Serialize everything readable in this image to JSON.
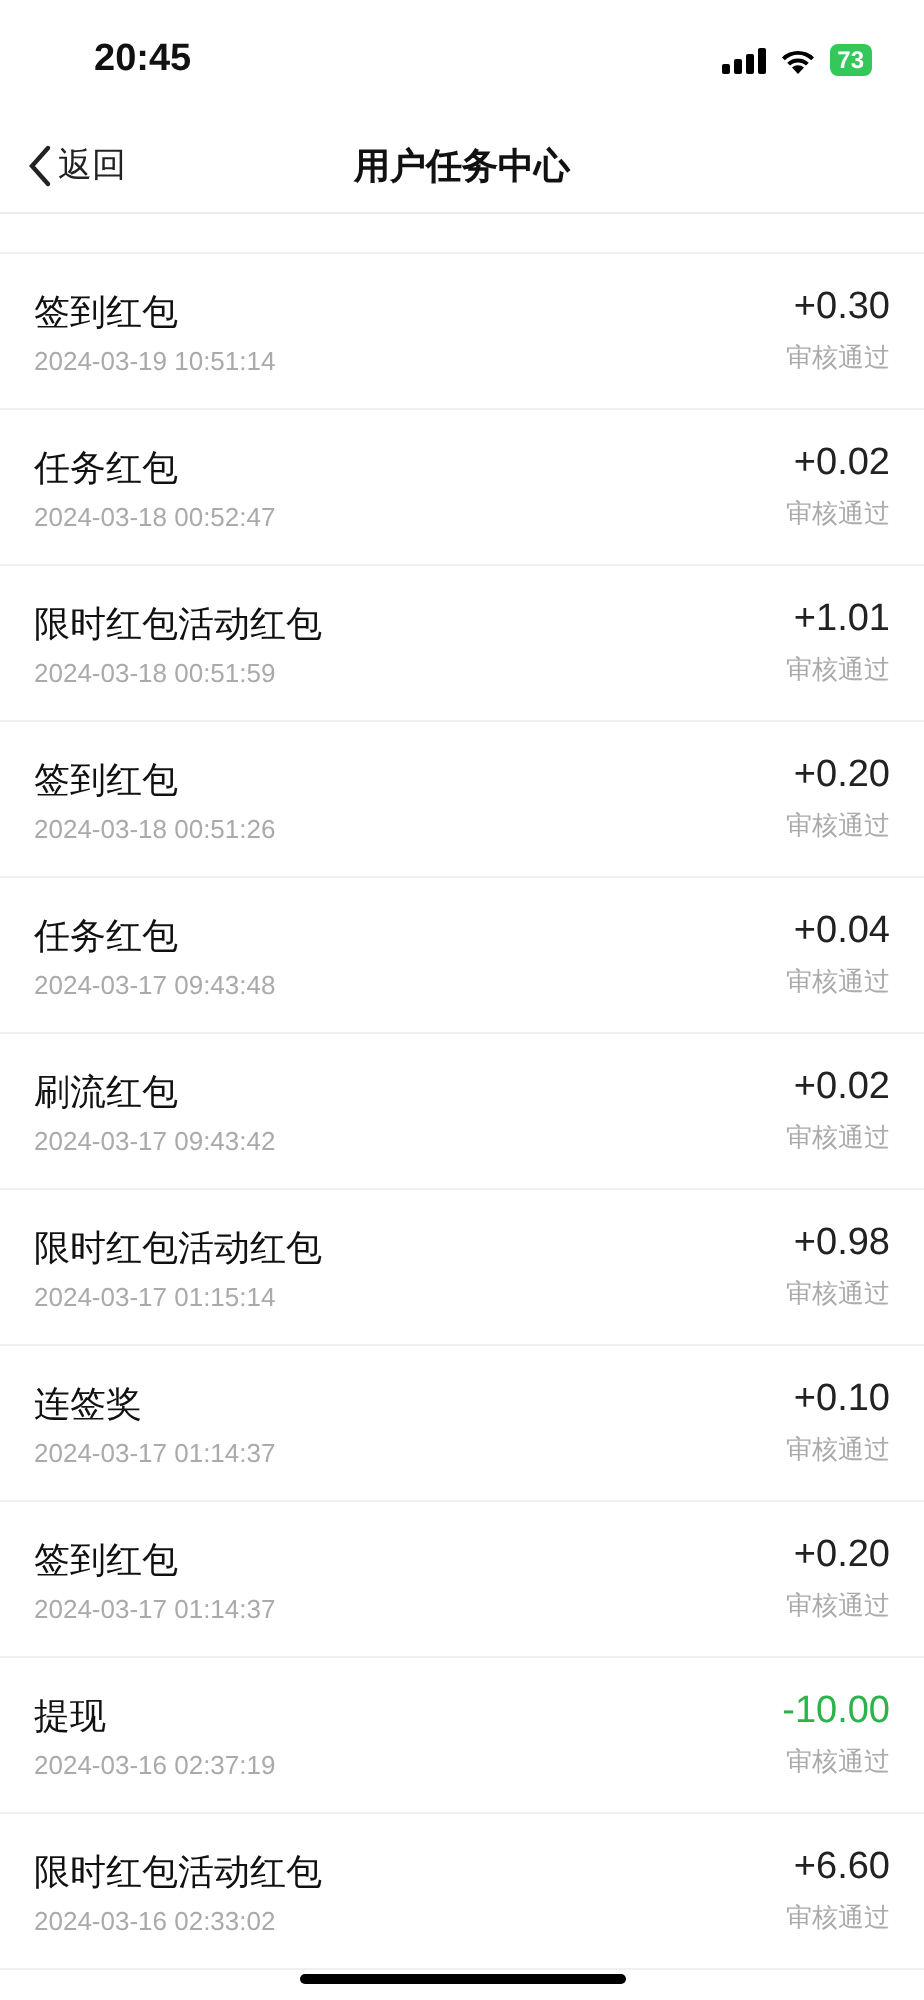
{
  "status_bar": {
    "time": "20:45",
    "battery": "73"
  },
  "nav": {
    "back": "返回",
    "title": "用户任务中心"
  },
  "records": [
    {
      "title": "签到红包",
      "time": "2024-03-19 10:51:14",
      "amount": "+0.30",
      "status": "审核通过",
      "kind": "income"
    },
    {
      "title": "任务红包",
      "time": "2024-03-18 00:52:47",
      "amount": "+0.02",
      "status": "审核通过",
      "kind": "income"
    },
    {
      "title": "限时红包活动红包",
      "time": "2024-03-18 00:51:59",
      "amount": "+1.01",
      "status": "审核通过",
      "kind": "income"
    },
    {
      "title": "签到红包",
      "time": "2024-03-18 00:51:26",
      "amount": "+0.20",
      "status": "审核通过",
      "kind": "income"
    },
    {
      "title": "任务红包",
      "time": "2024-03-17 09:43:48",
      "amount": "+0.04",
      "status": "审核通过",
      "kind": "income"
    },
    {
      "title": "刷流红包",
      "time": "2024-03-17 09:43:42",
      "amount": "+0.02",
      "status": "审核通过",
      "kind": "income"
    },
    {
      "title": "限时红包活动红包",
      "time": "2024-03-17 01:15:14",
      "amount": "+0.98",
      "status": "审核通过",
      "kind": "income"
    },
    {
      "title": "连签奖",
      "time": "2024-03-17 01:14:37",
      "amount": "+0.10",
      "status": "审核通过",
      "kind": "income"
    },
    {
      "title": "签到红包",
      "time": "2024-03-17 01:14:37",
      "amount": "+0.20",
      "status": "审核通过",
      "kind": "income"
    },
    {
      "title": "提现",
      "time": "2024-03-16 02:37:19",
      "amount": "-10.00",
      "status": "审核通过",
      "kind": "withdrawal"
    },
    {
      "title": "限时红包活动红包",
      "time": "2024-03-16 02:33:02",
      "amount": "+6.60",
      "status": "审核通过",
      "kind": "income"
    }
  ]
}
